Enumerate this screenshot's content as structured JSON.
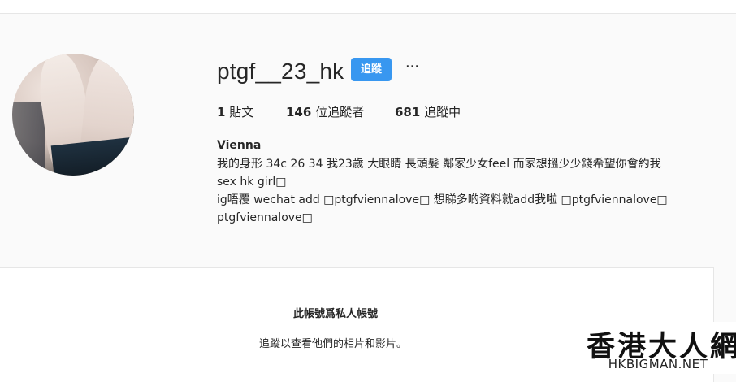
{
  "profile": {
    "username": "ptgf__23_hk",
    "follow_label": "追蹤",
    "more_label": "···",
    "stats": {
      "posts_count": "1",
      "posts_label": "貼文",
      "followers_count": "146",
      "followers_label": "位追蹤者",
      "following_count": "681",
      "following_label": "追蹤中"
    },
    "bio": {
      "name": "Vienna",
      "lines": [
        "我的身形 34c 26 34 我23歲 大眼睛 長頭髮 鄰家少女feel 而家想搵少少錢希望你會約我",
        "sex hk girl□",
        "ig唔覆 wechat add □ptgfviennalove□ 想睇多啲資料就add我啦 □ptgfviennalove□",
        "ptgfviennalove□"
      ]
    }
  },
  "private_notice": {
    "title": "此帳號爲私人帳號",
    "description": "追蹤以查看他們的相片和影片。"
  },
  "watermark": {
    "chinese": "香港大人網",
    "english": "HKBIGMAN.NET"
  },
  "colors": {
    "follow_button": "#3897f0",
    "background": "#fafafa"
  }
}
